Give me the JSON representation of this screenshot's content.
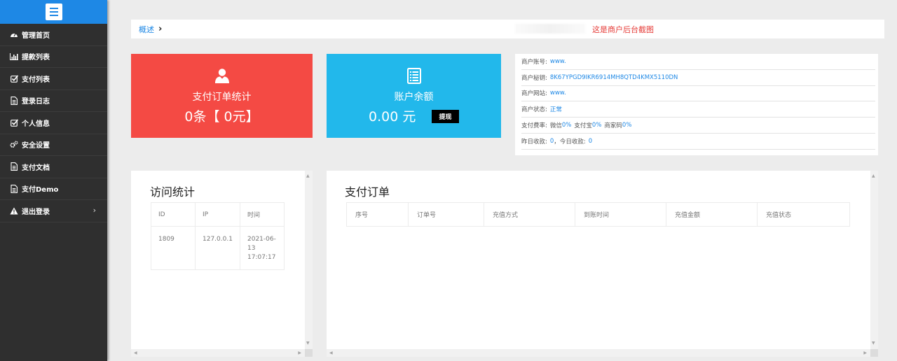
{
  "sidebar": {
    "items": [
      {
        "label": "管理首页",
        "icon": "dashboard-icon"
      },
      {
        "label": "提款列表",
        "icon": "bar-chart-icon"
      },
      {
        "label": "支付列表",
        "icon": "check-square-icon"
      },
      {
        "label": "登录日志",
        "icon": "document-icon"
      },
      {
        "label": "个人信息",
        "icon": "check-square-icon"
      },
      {
        "label": "安全设置",
        "icon": "gears-icon"
      },
      {
        "label": "支付文档",
        "icon": "document-icon"
      },
      {
        "label": "支付Demo",
        "icon": "document-icon"
      },
      {
        "label": "退出登录",
        "icon": "warning-icon"
      }
    ],
    "logout_arrow": "›"
  },
  "breadcrumb": {
    "link": "概述",
    "separator": "›",
    "note": "这是商户后台截图"
  },
  "cards": {
    "orders": {
      "title": "支付订单统计",
      "value": "0条【 0元】"
    },
    "balance": {
      "title": "账户余额",
      "value": "0.00 元",
      "button": "提现"
    }
  },
  "info": [
    {
      "label": "商户账号:",
      "value": "www."
    },
    {
      "label": "商户秘钥:",
      "value": "8K67YPGD9IKR6914MH8QTD4KMX5110DN"
    },
    {
      "label": "商户网站:",
      "value": "www."
    },
    {
      "label": "商户状态:",
      "value": "正常"
    },
    {
      "label": "支付费率:",
      "wx": "微信",
      "wx_v": "0%",
      "ali": "支付宝",
      "ali_v": "0%",
      "shop": "商家码",
      "shop_v": "0%"
    },
    {
      "label": "昨日收款:",
      "value": "0",
      "today_label": "今日收款:",
      "today_value": "0"
    }
  ],
  "visit": {
    "title": "访问统计",
    "headers": [
      "ID",
      "IP",
      "时间"
    ],
    "rows": [
      [
        "1809",
        "127.0.0.1",
        "2021-06-13 17:07:17"
      ]
    ]
  },
  "orders": {
    "title": "支付订单",
    "headers": [
      "序号",
      "订单号",
      "充值方式",
      "到账时间",
      "充值金额",
      "充值状态"
    ]
  },
  "colors": {
    "accent": "#1e88e5",
    "sidebar": "#2f2f2f",
    "card_red": "#f44a44",
    "card_blue": "#22b8eb",
    "note_red": "#e53935"
  }
}
